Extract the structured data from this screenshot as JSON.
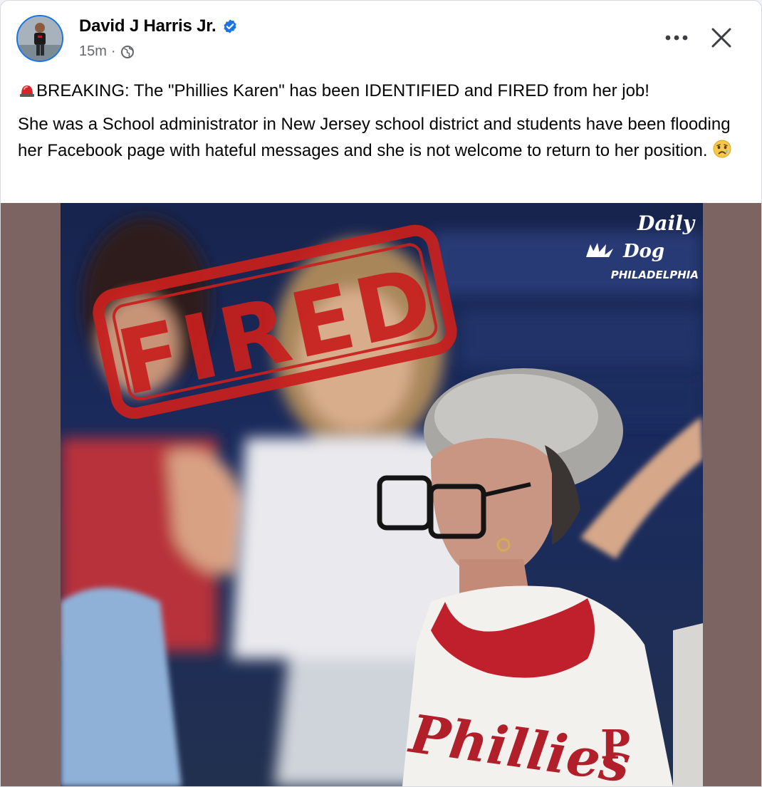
{
  "post": {
    "author": "David J Harris Jr.",
    "time": "15m",
    "separator": "·",
    "paragraph1_emoji": "siren-emoji",
    "paragraph1": "BREAKING: The \"Phillies Karen\" has been IDENTIFIED and FIRED from her job!",
    "paragraph2": "She was a School administrator in New Jersey school district and students have been flooding her Facebook page with hateful messages and she is not welcome to return to her position.",
    "paragraph2_emoji": "sad-face-emoji"
  },
  "media": {
    "stamp_text": "FIRED",
    "watermark_line1": "Daily",
    "watermark_line2": "Dog",
    "watermark_line3": "PHILADELPHIA",
    "jersey_script": "Phillies",
    "jersey_logo": "P"
  },
  "colors": {
    "verified": "#1b74e4",
    "stamp": "#c8201e",
    "media_background": "#7c6462",
    "hoodie_trim": "#c0202c"
  },
  "icons": [
    "verified-badge-icon",
    "globe-icon",
    "more-options-icon",
    "close-icon"
  ]
}
